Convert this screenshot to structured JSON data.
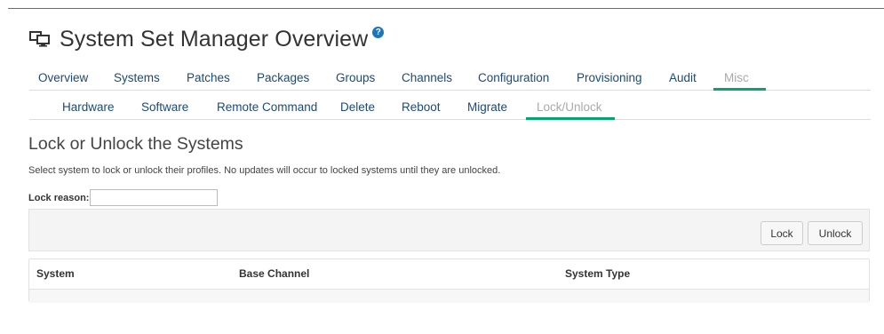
{
  "header": {
    "title": "System Set Manager Overview",
    "icon": "monitor-icon",
    "help_icon": "help-icon",
    "help_glyph": "?"
  },
  "nav": {
    "tabs": [
      {
        "label": "Overview"
      },
      {
        "label": "Systems"
      },
      {
        "label": "Patches"
      },
      {
        "label": "Packages"
      },
      {
        "label": "Groups"
      },
      {
        "label": "Channels"
      },
      {
        "label": "Configuration"
      },
      {
        "label": "Provisioning"
      },
      {
        "label": "Audit"
      },
      {
        "label": "Misc",
        "active": true
      }
    ],
    "subtabs": [
      {
        "label": "Hardware"
      },
      {
        "label": "Software"
      },
      {
        "label": "Remote Command"
      },
      {
        "label": "Delete"
      },
      {
        "label": "Reboot"
      },
      {
        "label": "Migrate"
      },
      {
        "label": "Lock/Unlock",
        "active": true
      }
    ]
  },
  "section": {
    "title": "Lock or Unlock the Systems",
    "description": "Select system to lock or unlock their profiles. No updates will occur to locked systems until they are unlocked."
  },
  "form": {
    "lock_reason_label": "Lock reason:",
    "lock_reason_value": ""
  },
  "actions": {
    "lock_label": "Lock",
    "unlock_label": "Unlock"
  },
  "table": {
    "columns": [
      "System",
      "Base Channel",
      "System Type"
    ],
    "rows": []
  },
  "colors": {
    "accent": "#00a86b",
    "link": "#1b4a7a",
    "help": "#1b75bb"
  }
}
